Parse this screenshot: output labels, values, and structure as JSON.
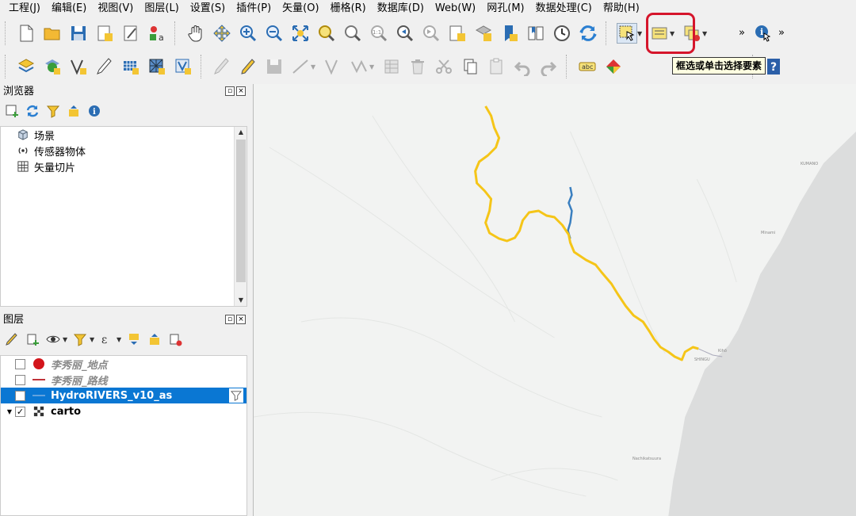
{
  "menu": [
    "工程(J)",
    "编辑(E)",
    "视图(V)",
    "图层(L)",
    "设置(S)",
    "插件(P)",
    "矢量(O)",
    "栅格(R)",
    "数据库(D)",
    "Web(W)",
    "网孔(M)",
    "数据处理(C)",
    "帮助(H)"
  ],
  "tooltip": "框选或单击选择要素",
  "toolbar": {
    "overflow": "»",
    "zoom_label": "1:1",
    "label_tool": "abc"
  },
  "browser": {
    "title": "浏览器",
    "items": [
      "场景",
      "传感器物体",
      "矢量切片"
    ]
  },
  "layers": {
    "title": "图层",
    "items": [
      {
        "name": "李秀丽_地点",
        "checked": false
      },
      {
        "name": "李秀丽_路线",
        "checked": false
      },
      {
        "name": "HydroRIVERS_v10_as",
        "checked": true
      },
      {
        "name": "carto",
        "checked": true
      }
    ]
  },
  "map": {
    "labels": [
      "KUMANO",
      "Minami",
      "Kihō",
      "SHINGU",
      "Nachikatsuura"
    ],
    "colors": {
      "river_highlight": "#f5c518",
      "river_blue": "#3a7fc0",
      "sea": "#dcdddd",
      "land": "#f2f3f2"
    }
  },
  "check_mark": "✓"
}
